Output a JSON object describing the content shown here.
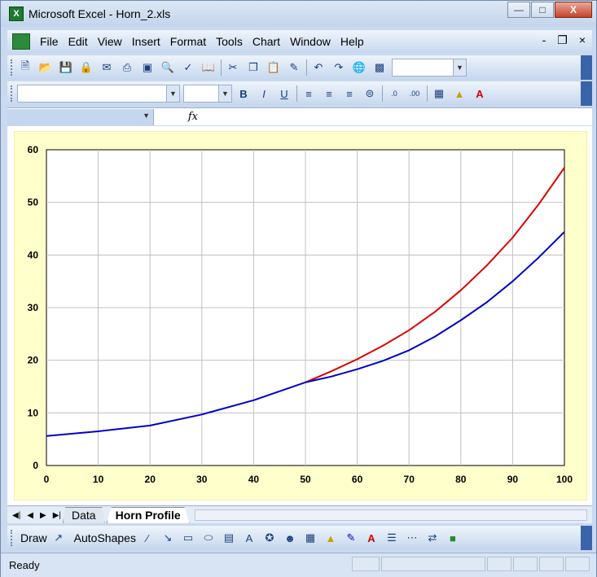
{
  "window": {
    "title": "Microsoft Excel - Horn_2.xls"
  },
  "menubar": {
    "items": [
      "File",
      "Edit",
      "View",
      "Insert",
      "Format",
      "Tools",
      "Chart",
      "Window",
      "Help"
    ],
    "controls": [
      "-",
      "❐",
      "×"
    ]
  },
  "formula": {
    "fx_label": "fx",
    "name_value": "",
    "formula_value": ""
  },
  "tabs": {
    "items": [
      "Data",
      "Horn Profile"
    ],
    "active": "Horn Profile"
  },
  "drawbar": {
    "draw_label": "Draw",
    "autoshapes_label": "AutoShapes"
  },
  "status": {
    "text": "Ready"
  },
  "colors": {
    "red_series": "#dd0000",
    "blue_series": "#0000cc",
    "chart_bg": "#ffffcc"
  },
  "chart_data": {
    "type": "line",
    "title": "",
    "xlabel": "",
    "ylabel": "",
    "xlim": [
      0,
      100
    ],
    "ylim": [
      0,
      60
    ],
    "xticks": [
      0,
      10,
      20,
      30,
      40,
      50,
      60,
      70,
      80,
      90,
      100
    ],
    "yticks": [
      0,
      10,
      20,
      30,
      40,
      50,
      60
    ],
    "grid": true,
    "legend": "none",
    "series": [
      {
        "color": "#dd0000",
        "x": [
          50,
          55,
          60,
          65,
          70,
          75,
          80,
          85,
          90,
          95,
          100
        ],
        "y": [
          15.8,
          17.9,
          20.2,
          22.8,
          25.7,
          29.2,
          33.3,
          38.0,
          43.3,
          49.6,
          56.6
        ]
      },
      {
        "color": "#0000cc",
        "x": [
          0,
          10,
          20,
          30,
          40,
          50,
          55,
          60,
          65,
          70,
          75,
          80,
          85,
          90,
          95,
          100
        ],
        "y": [
          5.6,
          6.5,
          7.6,
          9.7,
          12.4,
          15.8,
          16.9,
          18.3,
          19.9,
          21.9,
          24.5,
          27.6,
          31.0,
          35.0,
          39.5,
          44.4
        ]
      }
    ]
  }
}
